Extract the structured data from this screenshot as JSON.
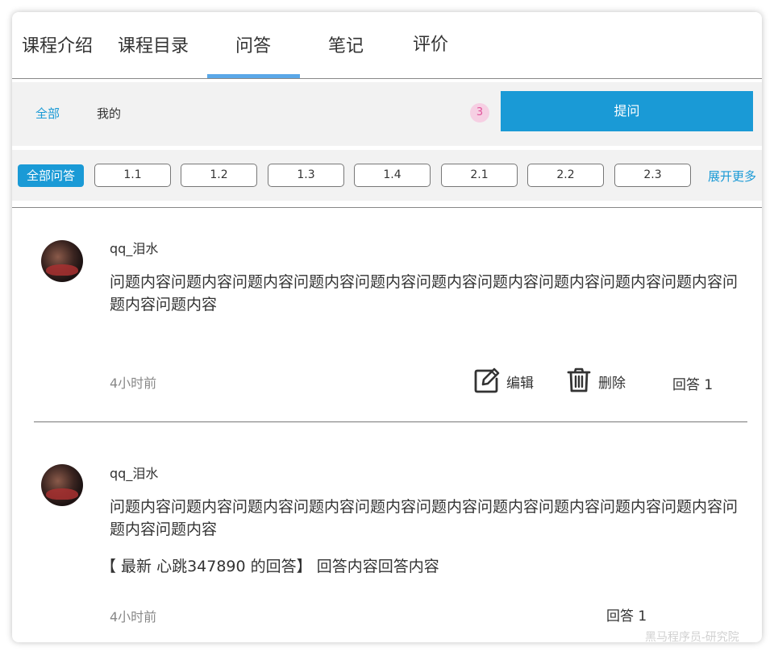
{
  "tabs": [
    {
      "label": "课程介绍"
    },
    {
      "label": "课程目录"
    },
    {
      "label": "问答"
    },
    {
      "label": "笔记"
    },
    {
      "label": "评价"
    }
  ],
  "filter": {
    "all_label": "全部",
    "mine_label": "我的",
    "count": "3",
    "ask_label": "提问"
  },
  "chapters": {
    "all_label": "全部问答",
    "items": [
      "1.1",
      "1.2",
      "1.3",
      "1.4",
      "2.1",
      "2.2",
      "2.3"
    ],
    "expand_label": "展开更多"
  },
  "questions": [
    {
      "username": "qq_泪水",
      "content": "问题内容问题内容问题内容问题内容问题内容问题内容问题内容问题内容问题内容问题内容问题内容问题内容",
      "time": "4小时前",
      "edit_label": "编辑",
      "delete_label": "删除",
      "answer_count": "回答 1"
    },
    {
      "username": "qq_泪水",
      "content": "问题内容问题内容问题内容问题内容问题内容问题内容问题内容问题内容问题内容问题内容问题内容问题内容",
      "latest_answer": "【 最新 心跳347890 的回答】 回答内容回答内容",
      "time": "4小时前",
      "answer_count": "回答 1"
    }
  ],
  "watermark": "黑马程序员-研究院",
  "colors": {
    "accent": "#1a9ad6",
    "tab_underline": "#5aa8e8",
    "badge_bg": "#f6cfe3",
    "badge_text": "#e0559b"
  },
  "icons": {
    "edit": "edit-icon",
    "delete": "trash-icon"
  }
}
